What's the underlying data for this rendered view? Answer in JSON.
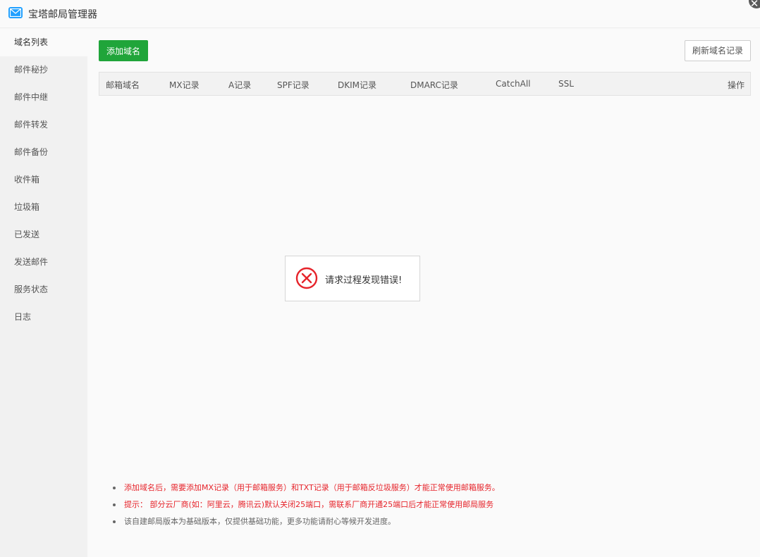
{
  "window": {
    "title": "宝塔邮局管理器",
    "close_glyph": "✕"
  },
  "sidebar": {
    "items": [
      {
        "label": "域名列表"
      },
      {
        "label": "邮件秘抄"
      },
      {
        "label": "邮件中继"
      },
      {
        "label": "邮件转发"
      },
      {
        "label": "邮件备份"
      },
      {
        "label": "收件箱"
      },
      {
        "label": "垃圾箱"
      },
      {
        "label": "已发送"
      },
      {
        "label": "发送邮件"
      },
      {
        "label": "服务状态"
      },
      {
        "label": "日志"
      }
    ],
    "active_index": 0
  },
  "toolbar": {
    "add_label": "添加域名",
    "refresh_label": "刷新域名记录"
  },
  "table": {
    "columns": [
      "邮箱域名",
      "MX记录",
      "A记录",
      "SPF记录",
      "DKIM记录",
      "DMARC记录",
      "CatchAll",
      "SSL",
      "操作"
    ],
    "rows": []
  },
  "error": {
    "message": "请求过程发现错误!"
  },
  "tips": [
    {
      "text": "添加域名后，需要添加MX记录（用于邮箱服务）和TXT记录（用于邮箱反垃圾服务）才能正常使用邮箱服务。",
      "tone": "red"
    },
    {
      "text": "提示：  部分云厂商(如：阿里云，腾讯云)默认关闭25端口，需联系厂商开通25端口后才能正常使用邮局服务",
      "tone": "red"
    },
    {
      "text": "该自建邮局版本为基础版本，仅提供基础功能，更多功能请耐心等候开发进度。",
      "tone": "grey"
    }
  ],
  "colors": {
    "primary_green": "#20a53a",
    "error_red": "#e6242b",
    "app_icon_blue": "#20a0ff"
  },
  "icons": {
    "app": "mail-icon",
    "close": "close-icon",
    "error": "error-circle-icon"
  }
}
